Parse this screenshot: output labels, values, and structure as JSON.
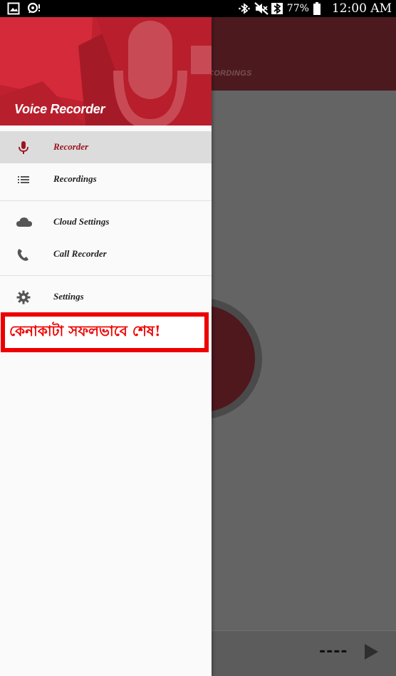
{
  "status_bar": {
    "battery": "77%",
    "time": "12:00 AM",
    "icons": [
      "gallery-icon",
      "chat-icon",
      "bluetooth-icon",
      "mute-icon",
      "bluetooth-icon",
      "battery-icon"
    ]
  },
  "drawer": {
    "title": "Voice Recorder",
    "items": [
      {
        "label": "Recorder",
        "icon": "mic-icon",
        "active": true
      },
      {
        "label": "Recordings",
        "icon": "list-icon",
        "active": false
      },
      {
        "label": "Cloud Settings",
        "icon": "cloud-icon",
        "active": false
      },
      {
        "label": "Call Recorder",
        "icon": "phone-icon",
        "active": false
      },
      {
        "label": "Settings",
        "icon": "gear-icon",
        "active": false
      }
    ]
  },
  "banner": {
    "text": "কেনাকাটা সফলভাবে  শেষ!"
  },
  "app": {
    "tab_label": "CORDINGS",
    "timer": "----"
  },
  "colors": {
    "accent": "#c62434",
    "active_label": "#9a1520",
    "toolbar": "#4c1a1e",
    "banner_red": "#ee0000"
  }
}
